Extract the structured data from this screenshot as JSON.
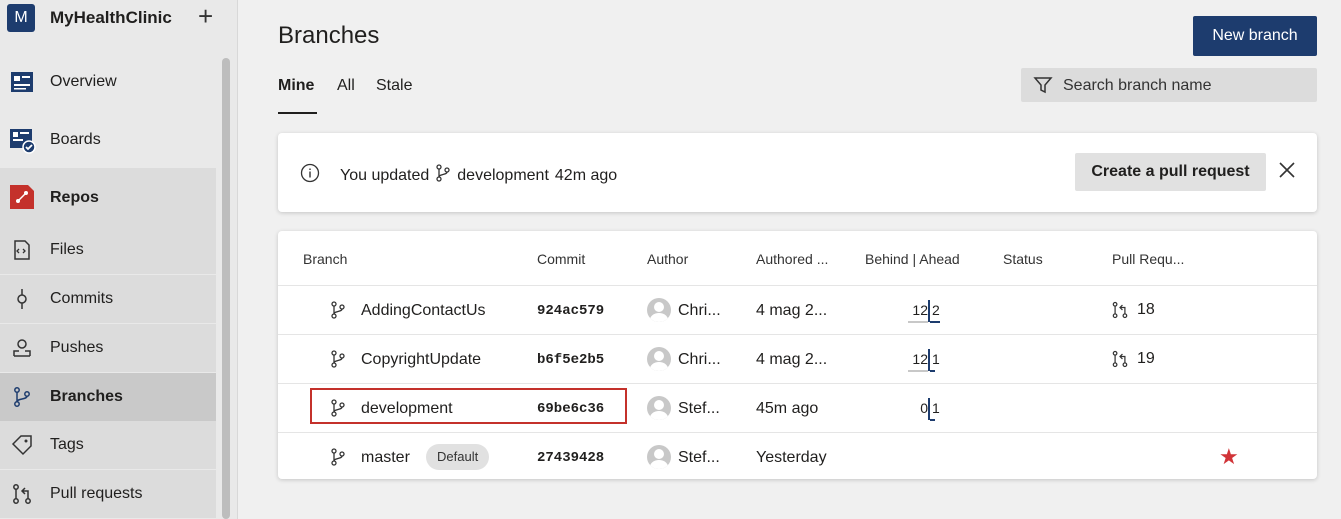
{
  "sidebar": {
    "org_initial": "M",
    "org_name": "MyHealthClinic",
    "add_label": "+",
    "items": [
      {
        "label": "Overview",
        "icon": "overview-icon"
      },
      {
        "label": "Boards",
        "icon": "boards-icon"
      },
      {
        "label": "Repos",
        "icon": "repos-icon"
      },
      {
        "label": "Files",
        "icon": "files-icon"
      },
      {
        "label": "Commits",
        "icon": "commits-icon"
      },
      {
        "label": "Pushes",
        "icon": "pushes-icon"
      },
      {
        "label": "Branches",
        "icon": "branches-icon"
      },
      {
        "label": "Tags",
        "icon": "tags-icon"
      },
      {
        "label": "Pull requests",
        "icon": "pull-requests-icon"
      }
    ],
    "selected": "Branches"
  },
  "header": {
    "title": "Branches",
    "new_branch_label": "New branch",
    "tabs": [
      {
        "label": "Mine",
        "active": true
      },
      {
        "label": "All",
        "active": false
      },
      {
        "label": "Stale",
        "active": false
      }
    ],
    "search_placeholder": "Search branch name"
  },
  "banner": {
    "prefix": "You updated",
    "branch": "development",
    "suffix": "42m ago",
    "action_label": "Create a pull request"
  },
  "table": {
    "columns": [
      "Branch",
      "Commit",
      "Author",
      "Authored ...",
      "Behind | Ahead",
      "Status",
      "Pull Requ..."
    ],
    "rows": [
      {
        "branch": "AddingContactUs",
        "commit": "924ac579",
        "author": "Chri...",
        "authored": "4 mag 2...",
        "behind": "12",
        "ahead": "2",
        "pr": "18",
        "default": "",
        "favorite": false
      },
      {
        "branch": "CopyrightUpdate",
        "commit": "b6f5e2b5",
        "author": "Chri...",
        "authored": "4 mag 2...",
        "behind": "12",
        "ahead": "1",
        "pr": "19",
        "default": "",
        "favorite": false
      },
      {
        "branch": "development",
        "commit": "69be6c36",
        "author": "Stef...",
        "authored": "45m ago",
        "behind": "0",
        "ahead": "1",
        "pr": "",
        "default": "",
        "favorite": false
      },
      {
        "branch": "master",
        "commit": "27439428",
        "author": "Stef...",
        "authored": "Yesterday",
        "behind": "",
        "ahead": "",
        "pr": "",
        "default": "Default",
        "favorite": true
      }
    ]
  },
  "colors": {
    "accent": "#1d3c6e",
    "repos_icon": "#c4312b",
    "favorite_star": "#d13438",
    "highlight_border": "#c4312b"
  }
}
